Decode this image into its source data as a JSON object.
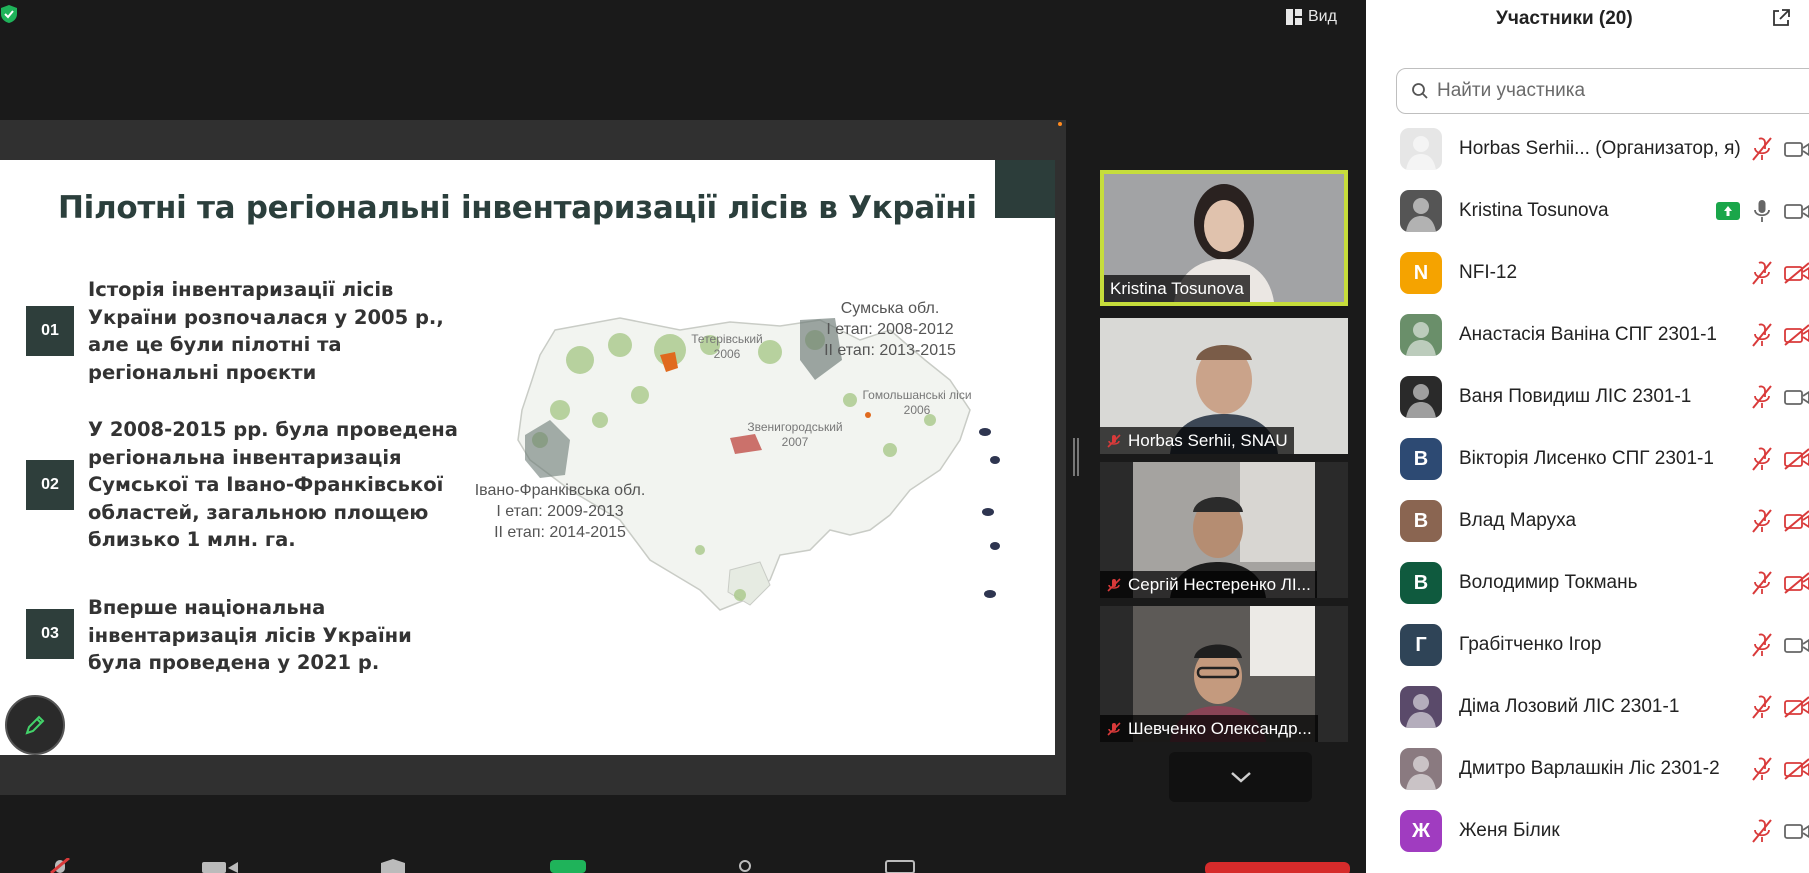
{
  "view": {
    "label": "Вид"
  },
  "slide": {
    "title": "Пілотні та регіональні інвентаризації лісів в Україні",
    "points": [
      {
        "num": "01",
        "text": "Історія інвентаризації лісів України розпочалася у 2005 р., але це були пілотні та регіональні проєкти"
      },
      {
        "num": "02",
        "text": "У 2008-2015 рр. була проведена регіональна інвентаризація Сумської та Івано-Франківської областей, загальною площею близько 1 млн. га."
      },
      {
        "num": "03",
        "text": "Вперше національна інвентаризація лісів України була проведена у 2021 р."
      }
    ],
    "map": {
      "sumy": [
        "Сумська обл.",
        "І етап: 2008-2012",
        "ІІ етап: 2013-2015"
      ],
      "ivano": [
        "Івано-Франківська обл.",
        "І етап: 2009-2013",
        "ІІ етап: 2014-2015"
      ],
      "teteriv": [
        "Тетерівський",
        "2006"
      ],
      "zvenyh": [
        "Звенигородський",
        "2007"
      ],
      "gomol": [
        "Гомольшанські ліси",
        "2006"
      ]
    }
  },
  "videos": [
    {
      "name": "Kristina Tosunova",
      "muted": false,
      "active": true
    },
    {
      "name": "Horbas Serhii, SNAU",
      "muted": true,
      "active": false
    },
    {
      "name": "Сергій Нестеренко ЛІ...",
      "muted": true,
      "active": false
    },
    {
      "name": "Шевченко Олександр...",
      "muted": true,
      "active": false
    }
  ],
  "panel": {
    "title": "Участники (20)",
    "search_placeholder": "Найти участника",
    "participants": [
      {
        "name": "Horbas Serhii... (Организатор, я)",
        "avatar": "",
        "color": "#e6e6e6",
        "mic": "muted",
        "cam": "on"
      },
      {
        "name": "Kristina Tosunova",
        "avatar": "",
        "color": "#555555",
        "mic": "on",
        "cam": "on",
        "sharing": true
      },
      {
        "name": "NFI-12",
        "avatar": "N",
        "color": "#f5a300",
        "mic": "muted",
        "cam": "off"
      },
      {
        "name": "Анастасія Ваніна СПГ 2301-1",
        "avatar": "",
        "color": "#6a8f6a",
        "mic": "muted",
        "cam": "off"
      },
      {
        "name": "Ваня Повидиш ЛІС 2301-1",
        "avatar": "",
        "color": "#2a2a2a",
        "mic": "muted",
        "cam": "on"
      },
      {
        "name": "Вікторія Лисенко СПГ 2301-1",
        "avatar": "В",
        "color": "#2d4a73",
        "mic": "muted",
        "cam": "off"
      },
      {
        "name": "Влад Маруха",
        "avatar": "В",
        "color": "#8a6551",
        "mic": "muted",
        "cam": "off"
      },
      {
        "name": "Володимир Токмань",
        "avatar": "В",
        "color": "#0f5a3e",
        "mic": "muted",
        "cam": "off"
      },
      {
        "name": "Грабітченко Ігор",
        "avatar": "Г",
        "color": "#2f4457",
        "mic": "muted",
        "cam": "on"
      },
      {
        "name": "Діма Лозовий ЛІС 2301-1",
        "avatar": "",
        "color": "#5a4a6a",
        "mic": "muted",
        "cam": "off"
      },
      {
        "name": "Дмитро Варлашкін Ліс 2301-2",
        "avatar": "",
        "color": "#8a7a80",
        "mic": "muted",
        "cam": "off"
      },
      {
        "name": "Женя Білик",
        "avatar": "Ж",
        "color": "#a03cc0",
        "mic": "muted",
        "cam": "on"
      }
    ]
  },
  "colors": {
    "active_speaker": "#c6dd3b",
    "muted_red": "#d93a3a",
    "slide_dark": "#2e3e3b"
  }
}
